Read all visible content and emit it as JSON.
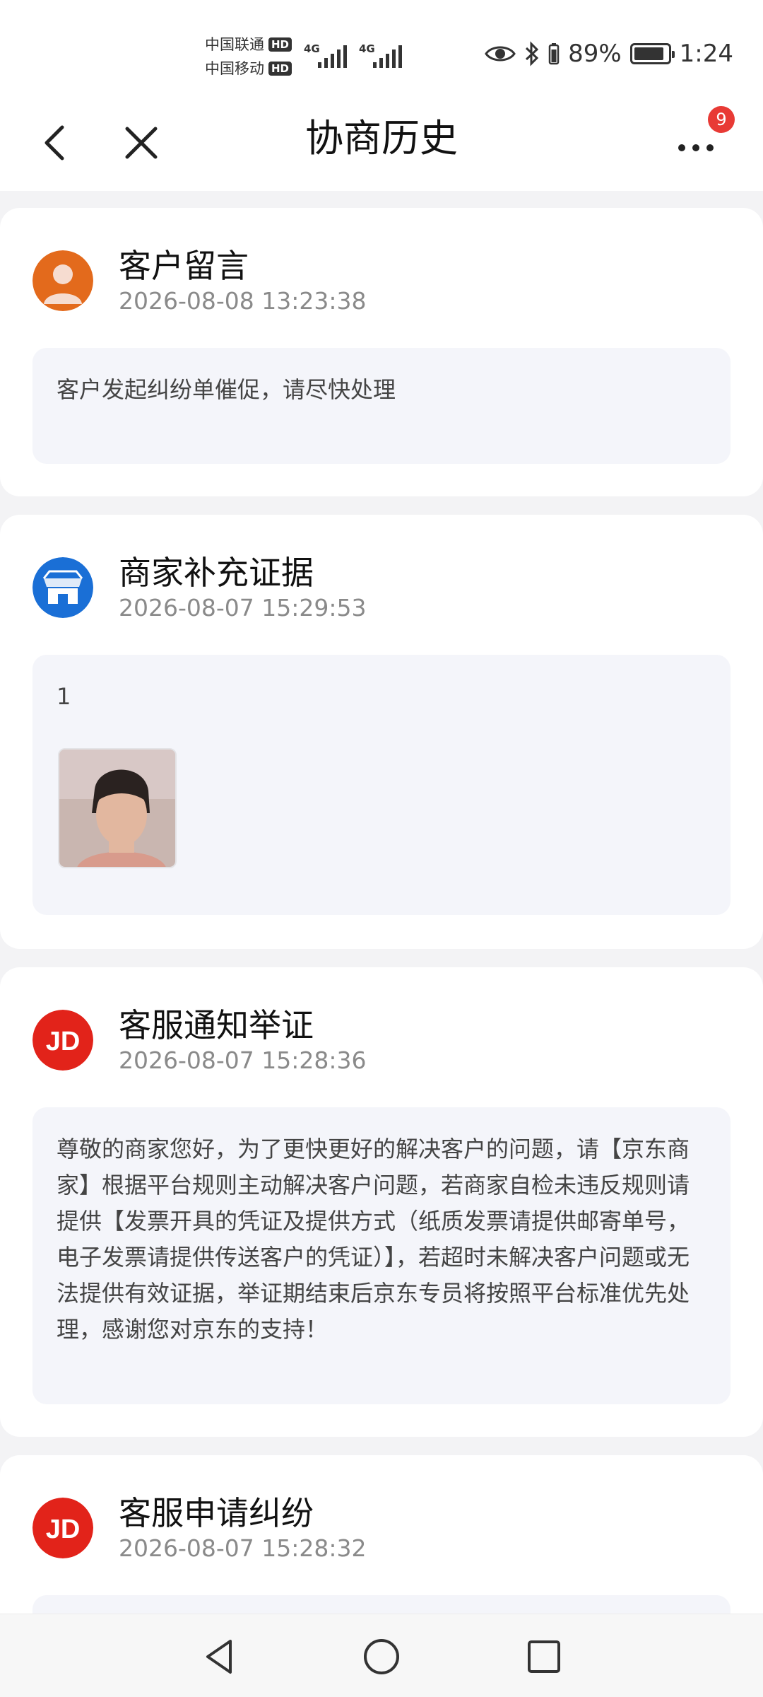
{
  "status_bar": {
    "carrier_1": "中国联通",
    "carrier_2": "中国移动",
    "hd_label": "HD",
    "network_1": "4G",
    "network_2": "4G",
    "battery_percent": "89%",
    "battery_level": 0.89,
    "time": "1:24"
  },
  "header": {
    "title": "协商历史",
    "notification_count": "9"
  },
  "history": [
    {
      "title": "客户留言",
      "time": "2026-08-08 13:23:38",
      "avatar": "customer-avatar-icon",
      "message": "客户发起纠纷单催促，请尽快处理"
    },
    {
      "title": "商家补充证据",
      "time": "2026-08-07 15:29:53",
      "avatar": "store-icon",
      "message": "1"
    },
    {
      "title": "客服通知举证",
      "time": "2026-08-07 15:28:36",
      "avatar": "jd-logo",
      "avatar_text": "JD",
      "message": "尊敬的商家您好，为了更快更好的解决客户的问题，请【京东商家】根据平台规则主动解决客户问题，若商家自检未违反规则请提供【发票开具的凭证及提供方式（纸质发票请提供邮寄单号，电子发票请提供传送客户的凭证）】，若超时未解决客户问题或无法提供有效证据，举证期结束后京东专员将按照平台标准优先处理，感谢您对京东的支持！"
    },
    {
      "title": "客服申请纠纷",
      "time": "2026-08-07 15:28:32",
      "avatar": "jd-logo",
      "avatar_text": "JD"
    }
  ],
  "colors": {
    "jd_red": "#e2231a",
    "customer_orange": "#e36a1c",
    "store_blue": "#1a6fd6",
    "badge_red": "#e83a35"
  }
}
